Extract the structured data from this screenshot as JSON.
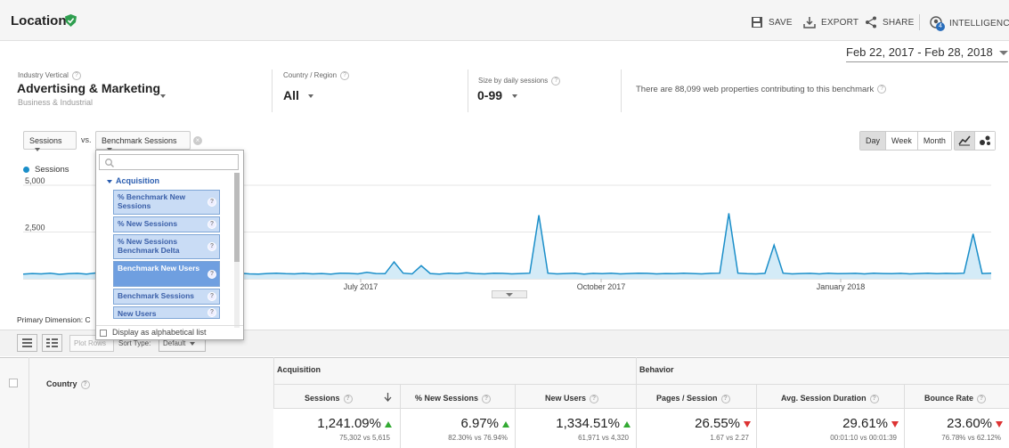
{
  "header": {
    "title": "Location",
    "actions": {
      "save": "SAVE",
      "export": "EXPORT",
      "share": "SHARE",
      "intelligence": "INTELLIGENCE",
      "intelligence_badge": "4"
    }
  },
  "date_range": "Feb 22, 2017 - Feb 28, 2018",
  "benchmark": {
    "industry": {
      "label": "Industry Vertical",
      "value": "Advertising & Marketing",
      "sub": "Business & Industrial"
    },
    "country": {
      "label": "Country / Region",
      "value": "All"
    },
    "size": {
      "label": "Size by daily sessions",
      "value": "0-99"
    },
    "note": "There are 88,099 web properties contributing to this benchmark"
  },
  "chart_controls": {
    "metric1": "Sessions",
    "vs": "vs.",
    "metric2": "Benchmark Sessions",
    "granularity": [
      "Day",
      "Week",
      "Month"
    ],
    "active_granularity": "Day"
  },
  "chart_data": {
    "type": "line",
    "legend": [
      "Sessions"
    ],
    "yticks": [
      "5,000",
      "2,500"
    ],
    "xticks": [
      "July 2017",
      "October 2017",
      "January 2018"
    ],
    "ylim": [
      0,
      5000
    ],
    "series": [
      {
        "name": "Sessions",
        "color": "#1a8ec9",
        "values": [
          250,
          280,
          260,
          300,
          240,
          270,
          290,
          250,
          310,
          260,
          280,
          240,
          300,
          270,
          260,
          290,
          250,
          280,
          300,
          260,
          240,
          290,
          270,
          280,
          300,
          260,
          250,
          280,
          300,
          270,
          260,
          290,
          260,
          280,
          250,
          300,
          290,
          260,
          350,
          280,
          270,
          900,
          300,
          260,
          700,
          280,
          250,
          300,
          270,
          320,
          280,
          260,
          300,
          290,
          260,
          280,
          300,
          3400,
          300,
          260,
          280,
          300,
          250,
          290,
          270,
          300,
          260,
          280,
          300,
          290,
          260,
          280,
          270,
          300,
          280,
          260,
          290,
          300,
          3500,
          300,
          270,
          260,
          290,
          1800,
          300,
          260,
          280,
          290,
          260,
          300,
          270,
          280,
          290,
          260,
          300,
          280,
          270,
          290,
          260,
          280,
          300,
          270,
          290,
          280,
          300,
          2400,
          280,
          300
        ]
      }
    ]
  },
  "dropdown": {
    "search_placeholder": "",
    "category": "Acquisition",
    "items": [
      "% Benchmark New Sessions",
      "% New Sessions",
      "% New Sessions Benchmark Delta",
      "Benchmark New Users",
      "Benchmark Sessions",
      "New Users"
    ],
    "selected_index": 3,
    "footer": "Display as alphabetical list"
  },
  "table": {
    "primary_dimension_label": "Primary Dimension:",
    "primary_dimension_value": "C",
    "plot_rows": "Plot Rows",
    "sort_type_label": "Sort Type:",
    "sort_type_value": "Default",
    "groups": [
      "Acquisition",
      "Behavior"
    ],
    "columns": [
      "Country",
      "Sessions",
      "% New Sessions",
      "New Users",
      "Pages / Session",
      "Avg. Session Duration",
      "Bounce Rate"
    ],
    "totals": [
      {
        "big": "1,241.09%",
        "small": "75,302 vs 5,615",
        "dir": "up"
      },
      {
        "big": "6.97%",
        "small": "82.30% vs 76.94%",
        "dir": "up"
      },
      {
        "big": "1,334.51%",
        "small": "61,971 vs 4,320",
        "dir": "up"
      },
      {
        "big": "26.55%",
        "small": "1.67 vs 2.27",
        "dir": "down"
      },
      {
        "big": "29.61%",
        "small": "00:01:10 vs 00:01:39",
        "dir": "down"
      },
      {
        "big": "23.60%",
        "small": "76.78% vs 62.12%",
        "dir": "down"
      }
    ]
  }
}
